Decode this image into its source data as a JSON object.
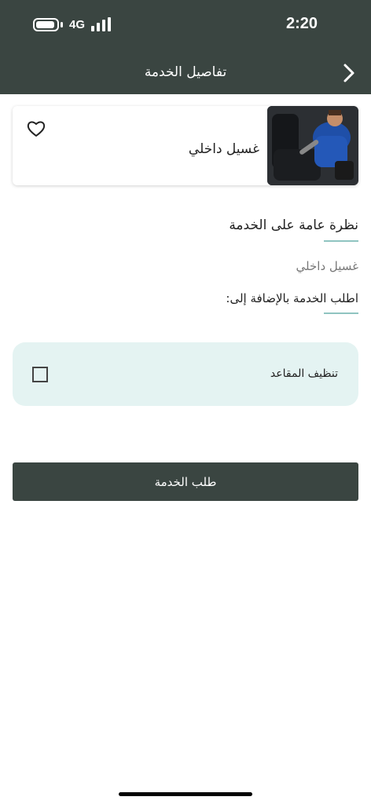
{
  "status_bar": {
    "time": "2:20",
    "network": "4G"
  },
  "header": {
    "title": "تفاصيل الخدمة"
  },
  "service_card": {
    "name": "غسيل داخلي"
  },
  "overview": {
    "heading": "نظرة عامة على الخدمة",
    "service_name": "غسيل داخلي",
    "addons_heading": "اطلب الخدمة بالإضافة إلى:"
  },
  "addons": [
    {
      "label": "تنظيف المقاعد",
      "checked": false
    }
  ],
  "order_button": {
    "label": "طلب الخدمة"
  },
  "colors": {
    "header_bg": "#3a4541",
    "accent_line": "#8fc4c0",
    "addon_bg": "#e4f3f2"
  }
}
